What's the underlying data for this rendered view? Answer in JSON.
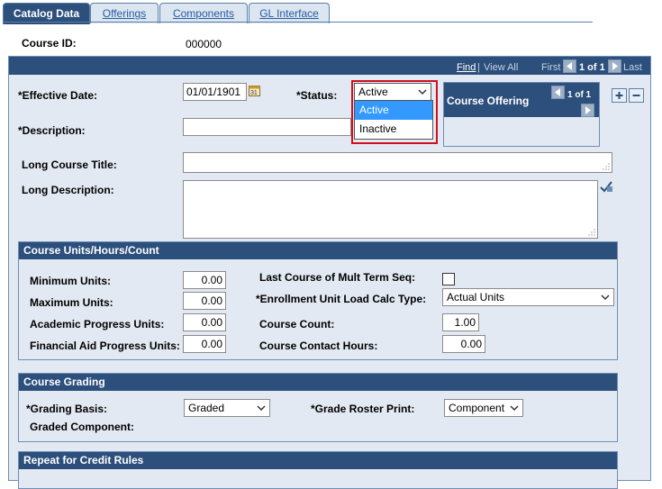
{
  "tabs": [
    {
      "label": "Catalog Data",
      "active": true
    },
    {
      "label": "Offerings",
      "active": false
    },
    {
      "label": "Components",
      "active": false
    },
    {
      "label": "GL Interface",
      "active": false
    }
  ],
  "course": {
    "id_label": "Course ID:",
    "id_value": "000000"
  },
  "nav": {
    "find": "Find",
    "sep": "|",
    "view_all": "View All",
    "first": "First",
    "count": "1 of 1",
    "last": "Last"
  },
  "effective_date": {
    "label": "*Effective Date:",
    "value": "01/01/1901"
  },
  "status": {
    "label": "*Status:",
    "value": "Active",
    "options": [
      "Active",
      "Inactive"
    ],
    "highlighted": "Active"
  },
  "description": {
    "label": "*Description:",
    "value": ""
  },
  "course_offering": {
    "title": "Course Offering",
    "count": "1 of 1"
  },
  "long_title": {
    "label": "Long Course Title:",
    "value": ""
  },
  "long_description": {
    "label": "Long Description:",
    "value": ""
  },
  "units_section": {
    "title": "Course Units/Hours/Count",
    "min_units": {
      "label": "Minimum Units:",
      "value": "0.00"
    },
    "max_units": {
      "label": "Maximum Units:",
      "value": "0.00"
    },
    "academic_progress": {
      "label": "Academic Progress Units:",
      "value": "0.00"
    },
    "financial_aid": {
      "label": "Financial Aid Progress Units:",
      "value": "0.00"
    },
    "last_course": {
      "label": "Last Course of Mult Term Seq:",
      "checked": false
    },
    "enrollment_calc": {
      "label": "*Enrollment Unit Load Calc Type:",
      "value": "Actual Units"
    },
    "course_count": {
      "label": "Course Count:",
      "value": "1.00"
    },
    "contact_hours": {
      "label": "Course Contact Hours:",
      "value": "0.00"
    }
  },
  "grading_section": {
    "title": "Course Grading",
    "grading_basis": {
      "label": "*Grading Basis:",
      "value": "Graded"
    },
    "graded_component": {
      "label": "Graded Component:"
    },
    "grade_roster": {
      "label": "*Grade Roster Print:",
      "value": "Component"
    }
  },
  "repeat_section": {
    "title": "Repeat for Credit Rules"
  },
  "colors": {
    "header": "#2c4f7c",
    "panel": "#e3e9f2",
    "highlight": "#3399ff",
    "focus_frame": "#d00f1f"
  }
}
